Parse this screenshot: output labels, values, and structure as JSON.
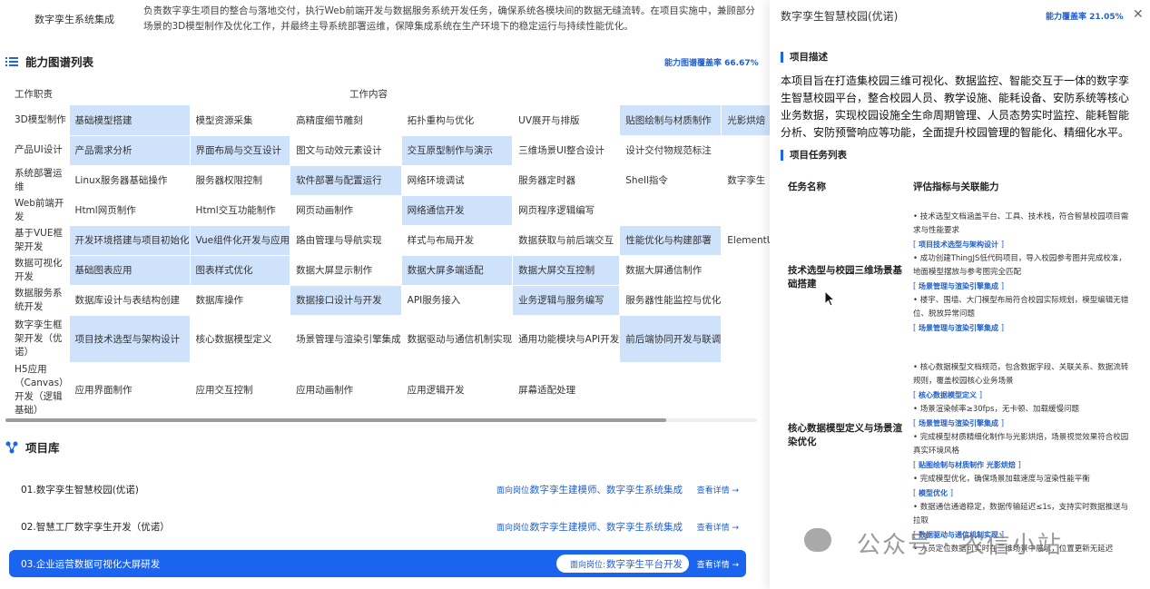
{
  "header": {
    "role": "数字孪生系统集成",
    "desc": "负责数字孪生项目的整合与落地交付，执行Web前端开发与数据服务系统开发任务，确保系统各模块间的数据无缝流转。在项目实施中，兼顾部分场景的3D模型制作及优化工作，并最终主导系统部署运维，保障集成系统在生产环境下的稳定运行与持续性能优化。"
  },
  "capability": {
    "title": "能力图谱列表",
    "coverage": "能力图谱覆盖率 66.67%",
    "col_role": "工作职责",
    "col_content": "工作内容",
    "rows": [
      {
        "role": "3D模型制作",
        "cells": [
          [
            "基础模型搭建",
            1
          ],
          [
            "模型资源采集",
            0
          ],
          [
            "高精度细节雕刻",
            0
          ],
          [
            "拓扑重构与优化",
            0
          ],
          [
            "UV展开与排版",
            0
          ],
          [
            "贴图绘制与材质制作",
            1
          ],
          [
            "光影烘焙",
            1
          ]
        ]
      },
      {
        "role": "产品UI设计",
        "cells": [
          [
            "产品需求分析",
            1
          ],
          [
            "界面布局与交互设计",
            1
          ],
          [
            "图文与动效元素设计",
            0
          ],
          [
            "交互原型制作与演示",
            1
          ],
          [
            "三维场景UI整合设计",
            0
          ],
          [
            "设计交付物规范标注",
            0
          ],
          [
            "",
            0
          ]
        ]
      },
      {
        "role": "系统部署运维",
        "cells": [
          [
            "Linux服务器基础操作",
            0
          ],
          [
            "服务器权限控制",
            0
          ],
          [
            "软件部署与配置运行",
            1
          ],
          [
            "网络环境调试",
            0
          ],
          [
            "服务器定时器",
            0
          ],
          [
            "Shell指令",
            0
          ],
          [
            "数字孪生",
            0
          ]
        ]
      },
      {
        "role": "Web前端开发",
        "cells": [
          [
            "Html网页制作",
            0
          ],
          [
            "Html交互功能制作",
            0
          ],
          [
            "网页动画制作",
            0
          ],
          [
            "网络通信开发",
            1
          ],
          [
            "网页程序逻辑编写",
            0
          ],
          [
            "",
            0
          ],
          [
            "",
            0
          ]
        ]
      },
      {
        "role": "基于VUE框架开发",
        "cells": [
          [
            "开发环境搭建与项目初始化",
            1
          ],
          [
            "Vue组件化开发与应用",
            1
          ],
          [
            "路由管理与导航实现",
            0
          ],
          [
            "样式与布局开发",
            0
          ],
          [
            "数据获取与前后端交互",
            0
          ],
          [
            "性能优化与构建部署",
            1
          ],
          [
            "ElementUI",
            0
          ]
        ]
      },
      {
        "role": "数据可视化开发",
        "cells": [
          [
            "基础图表应用",
            1
          ],
          [
            "图表样式优化",
            1
          ],
          [
            "数据大屏显示制作",
            0
          ],
          [
            "数据大屏多端适配",
            1
          ],
          [
            "数据大屏交互控制",
            1
          ],
          [
            "数据大屏通信制作",
            0
          ],
          [
            "",
            0
          ]
        ]
      },
      {
        "role": "数据服务系统开发",
        "cells": [
          [
            "数据库设计与表结构创建",
            0
          ],
          [
            "数据库操作",
            0
          ],
          [
            "数据接口设计与开发",
            1
          ],
          [
            "API服务接入",
            0
          ],
          [
            "业务逻辑与服务编写",
            1
          ],
          [
            "服务器性能监控与优化",
            0
          ],
          [
            "",
            0
          ]
        ]
      },
      {
        "role": "数字孪生框架开发（优诺）",
        "cells": [
          [
            "项目技术选型与架构设计",
            1
          ],
          [
            "核心数据模型定义",
            0
          ],
          [
            "场景管理与渲染引擎集成",
            0
          ],
          [
            "数据驱动与通信机制实现",
            0
          ],
          [
            "通用功能模块与API开发",
            0
          ],
          [
            "前后端协同开发与联调",
            1
          ],
          [
            "",
            0
          ]
        ]
      },
      {
        "role": "H5应用（Canvas）开发（逻辑基础）",
        "cells": [
          [
            "应用界面制作",
            0
          ],
          [
            "应用交互控制",
            0
          ],
          [
            "应用动画制作",
            0
          ],
          [
            "应用逻辑开发",
            0
          ],
          [
            "屏幕适配处理",
            0
          ],
          [
            "",
            0
          ],
          [
            "",
            0
          ]
        ]
      }
    ]
  },
  "projects": {
    "title": "项目库",
    "for_label": "面向岗位:",
    "detail_label": "查看详情 →",
    "items": [
      {
        "name": "01.数字孪生智慧校园(优诺)",
        "roles": "数字孪生建模师、数字孪生系统集成"
      },
      {
        "name": "02.智慧工厂数字孪生开发（优诺）",
        "roles": "数字孪生建模师、数字孪生系统集成"
      },
      {
        "name": "03.企业运营数据可视化大屏研发",
        "roles": "数字孪生平台开发"
      }
    ]
  },
  "panel": {
    "title": "数字孪生智慧校园(优诺)",
    "coverage": "能力覆盖率 21.05%",
    "close": "✕",
    "desc_title": "项目描述",
    "desc": "本项目旨在打造集校园三维可视化、数据监控、智能交互于一体的数字孪生智慧校园平台，整合校园人员、教学设施、能耗设备、安防系统等核心业务数据，实现校园设施全生命周期管理、人员态势实时监控、能耗智能分析、安防预警响应等功能，全面提升校园管理的智能化、精细化水平。",
    "tasks_title": "项目任务列表",
    "col_task": "任务名称",
    "col_crit": "评估指标与关联能力",
    "tasks": [
      {
        "name": "技术选型与校园三维场景基础搭建",
        "items": [
          {
            "text": "• 技术选型文档涵盖平台、工具、技术栈，符合智慧校园项目需求与性能要求",
            "tags": "项目技术选型与架构设计"
          },
          {
            "text": "• 成功创建ThingJS低代码项目，导入校园参考图并完成校准，地面模型摆放与参考图完全匹配",
            "tags": "场景管理与渲染引擎集成"
          },
          {
            "text": "• 楼宇、围墙、大门模型布局符合校园实际规划，模型编辑无错位、脱放异常问题",
            "tags": "场景管理与渲染引擎集成"
          }
        ]
      },
      {
        "name": "核心数据模型定义与场景渲染优化",
        "items": [
          {
            "text": "• 核心数据模型文档规范，包含数据字段、关联关系、数据流转规则，覆盖校园核心业务场景",
            "tags": "核心数据模型定义"
          },
          {
            "text": "• 场景渲染帧率≥30fps，无卡顿、加载缓慢问题",
            "tags": "场景管理与渲染引擎集成"
          },
          {
            "text": "• 完成模型材质精细化制作与光影烘焙，场景视觉效果符合校园真实环境风格",
            "tags": "贴图绘制与材质制作   光影烘焙"
          },
          {
            "text": "• 完成模型优化，确保场景加载速度与渲染性能平衡",
            "tags": "模型优化"
          },
          {
            "text": "• 数据通信通道稳定，数据传输延迟≤1s，支持实时数据推送与拉取",
            "tags": "数据驱动与通信机制实现"
          },
          {
            "text": "• 人员定位数据可实时在三维场景中展示，位置更新无延迟",
            "tags": ""
          }
        ]
      }
    ],
    "watermark": "公众号 · 农信小站"
  }
}
